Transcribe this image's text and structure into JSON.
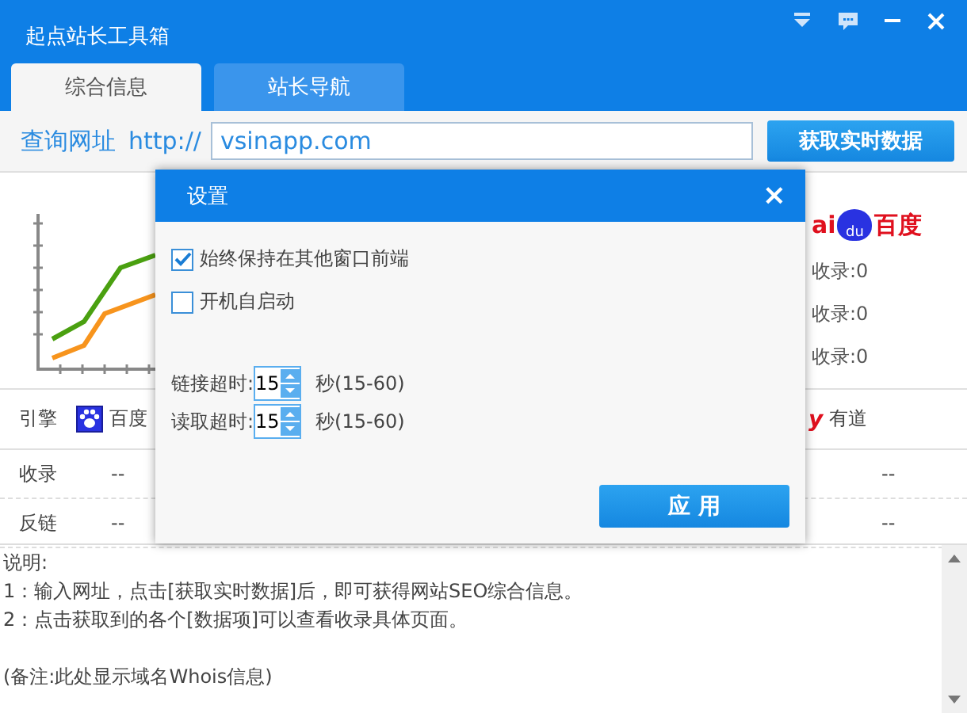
{
  "window": {
    "title": "起点站长工具箱"
  },
  "tabs": [
    {
      "label": "综合信息",
      "selected": true
    },
    {
      "label": "站长导航",
      "selected": false
    }
  ],
  "query": {
    "label": "查询网址",
    "prefix": "http://",
    "value": "vsinapp.com",
    "button": "获取实时数据"
  },
  "overview": {
    "logo_text": "ai",
    "logo_badge": "du",
    "logo_name": "百度",
    "stats": [
      "收录:0",
      "收录:0",
      "收录:0"
    ]
  },
  "table": {
    "columns": [
      {
        "label": "引擎",
        "kind": "plain"
      },
      {
        "label": "百度",
        "kind": "baidu"
      },
      {
        "label": "有道",
        "kind": "youdao",
        "mark": "y"
      }
    ],
    "rows": [
      {
        "cells": [
          "收录",
          "--",
          "--"
        ]
      },
      {
        "cells": [
          "反链",
          "--",
          "--"
        ]
      }
    ]
  },
  "notes": [
    {
      "lines": [
        "说明:",
        "1：输入网址，点击[获取实时数据]后，即可获得网站SEO综合信息。",
        "2：点击获取到的各个[数据项]可以查看收录具体页面。"
      ]
    },
    {
      "lines": [
        "(备注:此处显示域名Whois信息)"
      ]
    }
  ],
  "dialog": {
    "title": "设置",
    "close": "×",
    "options": [
      {
        "label": "始终保持在其他窗口前端",
        "checked": true
      },
      {
        "label": "开机自启动",
        "checked": false
      }
    ],
    "timeouts": [
      {
        "label": "链接超时:",
        "value": "15",
        "unit": "秒(15-60)"
      },
      {
        "label": "读取超时:",
        "value": "15",
        "unit": "秒(15-60)"
      }
    ],
    "button": "应 用"
  }
}
